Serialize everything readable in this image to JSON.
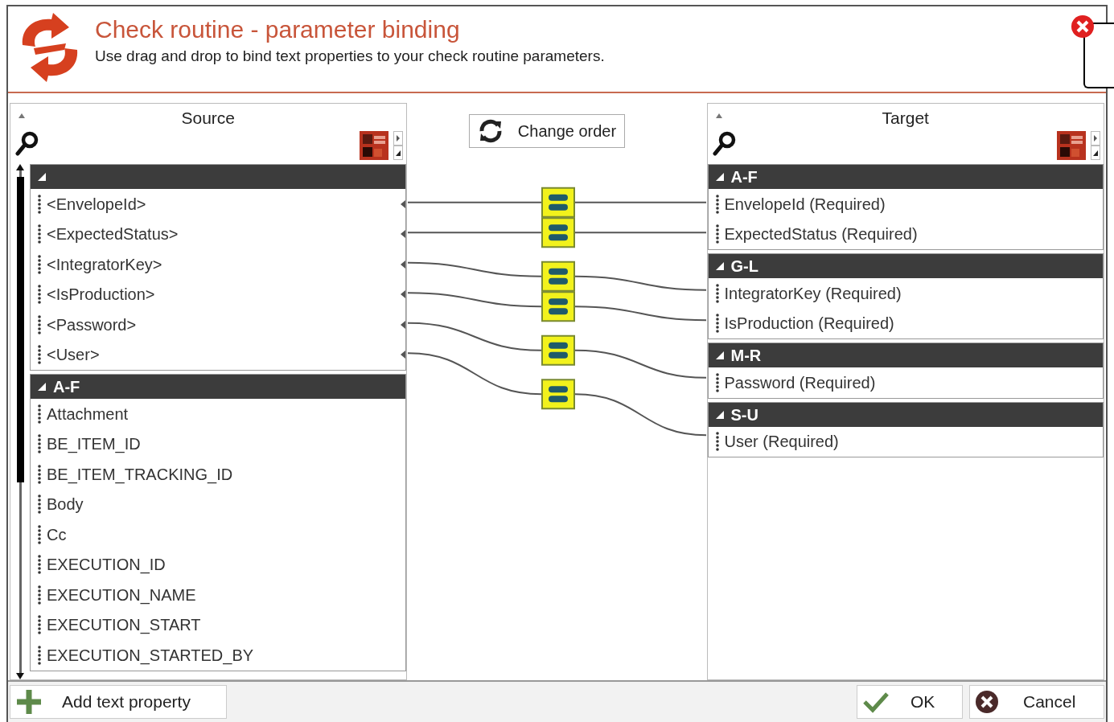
{
  "dialog": {
    "title": "Check routine - parameter binding",
    "subtitle": "Use drag and drop to bind text properties to your check routine parameters."
  },
  "source": {
    "title": "Source",
    "groups": [
      {
        "expanded": true,
        "items": [
          {
            "label": "<EnvelopeId>",
            "bound": true
          },
          {
            "label": "<ExpectedStatus>",
            "bound": true
          },
          {
            "label": "<IntegratorKey>",
            "bound": true
          },
          {
            "label": "<IsProduction>",
            "bound": true
          },
          {
            "label": "<Password>",
            "bound": true
          },
          {
            "label": "<User>",
            "bound": true
          }
        ]
      },
      {
        "label": "A-F",
        "expanded": true,
        "items": [
          {
            "label": "Attachment",
            "bound": false
          },
          {
            "label": "BE_ITEM_ID",
            "bound": false
          },
          {
            "label": "BE_ITEM_TRACKING_ID",
            "bound": false
          },
          {
            "label": "Body",
            "bound": false
          },
          {
            "label": "Cc",
            "bound": false
          },
          {
            "label": "EXECUTION_ID",
            "bound": false
          },
          {
            "label": "EXECUTION_NAME",
            "bound": false
          },
          {
            "label": "EXECUTION_START",
            "bound": false
          },
          {
            "label": "EXECUTION_STARTED_BY",
            "bound": false
          }
        ]
      }
    ]
  },
  "change_order_button": "Change order",
  "target": {
    "title": "Target",
    "groups": [
      {
        "label": "A-F",
        "expanded": true,
        "items": [
          {
            "label": "EnvelopeId (Required)"
          },
          {
            "label": "ExpectedStatus (Required)"
          }
        ]
      },
      {
        "label": "G-L",
        "expanded": true,
        "items": [
          {
            "label": "IntegratorKey (Required)"
          },
          {
            "label": "IsProduction (Required)"
          }
        ]
      },
      {
        "label": "M-R",
        "expanded": true,
        "items": [
          {
            "label": "Password (Required)"
          }
        ]
      },
      {
        "label": "S-U",
        "expanded": true,
        "items": [
          {
            "label": "User (Required)"
          }
        ]
      }
    ]
  },
  "footer": {
    "add_button": "Add text property",
    "ok_button": "OK",
    "cancel_button": "Cancel"
  }
}
